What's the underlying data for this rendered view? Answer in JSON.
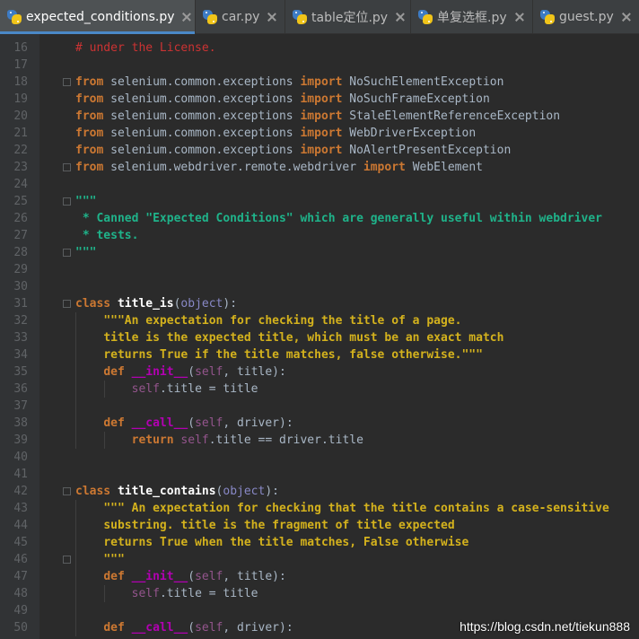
{
  "tabs": [
    {
      "label": "expected_conditions.py",
      "active": true
    },
    {
      "label": "car.py",
      "active": false
    },
    {
      "label": "table定位.py",
      "active": false
    },
    {
      "label": "单复选框.py",
      "active": false
    },
    {
      "label": "guest.py",
      "active": false
    }
  ],
  "lines": [
    {
      "n": "16",
      "tokens": [
        {
          "t": "# under the License.",
          "c": "cmt"
        }
      ]
    },
    {
      "n": "17",
      "tokens": []
    },
    {
      "n": "18",
      "tokens": [
        {
          "t": "from",
          "c": "kw"
        },
        {
          "t": " selenium.common.exceptions ",
          "c": "plain"
        },
        {
          "t": "import",
          "c": "kw"
        },
        {
          "t": " NoSuchElementException",
          "c": "plain"
        }
      ]
    },
    {
      "n": "19",
      "tokens": [
        {
          "t": "from",
          "c": "kw"
        },
        {
          "t": " selenium.common.exceptions ",
          "c": "plain"
        },
        {
          "t": "import",
          "c": "kw"
        },
        {
          "t": " NoSuchFrameException",
          "c": "plain"
        }
      ]
    },
    {
      "n": "20",
      "tokens": [
        {
          "t": "from",
          "c": "kw"
        },
        {
          "t": " selenium.common.exceptions ",
          "c": "plain"
        },
        {
          "t": "import",
          "c": "kw"
        },
        {
          "t": " StaleElementReferenceException",
          "c": "plain"
        }
      ]
    },
    {
      "n": "21",
      "tokens": [
        {
          "t": "from",
          "c": "kw"
        },
        {
          "t": " selenium.common.exceptions ",
          "c": "plain"
        },
        {
          "t": "import",
          "c": "kw"
        },
        {
          "t": " WebDriverException",
          "c": "plain"
        }
      ]
    },
    {
      "n": "22",
      "tokens": [
        {
          "t": "from",
          "c": "kw"
        },
        {
          "t": " selenium.common.exceptions ",
          "c": "plain"
        },
        {
          "t": "import",
          "c": "kw"
        },
        {
          "t": " NoAlertPresentException",
          "c": "plain"
        }
      ]
    },
    {
      "n": "23",
      "tokens": [
        {
          "t": "from",
          "c": "kw"
        },
        {
          "t": " selenium.webdriver.remote.webdriver ",
          "c": "plain"
        },
        {
          "t": "import",
          "c": "kw"
        },
        {
          "t": " WebElement",
          "c": "plain"
        }
      ]
    },
    {
      "n": "24",
      "tokens": []
    },
    {
      "n": "25",
      "tokens": [
        {
          "t": "\"\"\"",
          "c": "doc2"
        }
      ]
    },
    {
      "n": "26",
      "tokens": [
        {
          "t": " * Canned \"Expected Conditions\" which are generally useful within webdriver",
          "c": "doc2"
        }
      ]
    },
    {
      "n": "27",
      "tokens": [
        {
          "t": " * tests.",
          "c": "doc2"
        }
      ]
    },
    {
      "n": "28",
      "tokens": [
        {
          "t": "\"\"\"",
          "c": "doc2"
        }
      ]
    },
    {
      "n": "29",
      "tokens": []
    },
    {
      "n": "30",
      "tokens": []
    },
    {
      "n": "31",
      "tokens": [
        {
          "t": "class",
          "c": "kw"
        },
        {
          "t": " ",
          "c": "plain"
        },
        {
          "t": "title_is",
          "c": "cls"
        },
        {
          "t": "(",
          "c": "plain"
        },
        {
          "t": "object",
          "c": "builtin"
        },
        {
          "t": "):",
          "c": "plain"
        }
      ]
    },
    {
      "n": "32",
      "tokens": [
        {
          "t": "    ",
          "c": "plain"
        },
        {
          "t": "\"\"\"An expectation for checking the title of a page.",
          "c": "doc"
        }
      ]
    },
    {
      "n": "33",
      "tokens": [
        {
          "t": "    ",
          "c": "plain"
        },
        {
          "t": "title is the expected title, which must be an exact match",
          "c": "doc"
        }
      ]
    },
    {
      "n": "34",
      "tokens": [
        {
          "t": "    ",
          "c": "plain"
        },
        {
          "t": "returns True if the title matches, false otherwise.\"\"\"",
          "c": "doc"
        }
      ]
    },
    {
      "n": "35",
      "tokens": [
        {
          "t": "    ",
          "c": "plain"
        },
        {
          "t": "def",
          "c": "kw"
        },
        {
          "t": " ",
          "c": "plain"
        },
        {
          "t": "__init__",
          "c": "magic"
        },
        {
          "t": "(",
          "c": "plain"
        },
        {
          "t": "self",
          "c": "selfkw"
        },
        {
          "t": ", title):",
          "c": "plain"
        }
      ]
    },
    {
      "n": "36",
      "tokens": [
        {
          "t": "        ",
          "c": "plain"
        },
        {
          "t": "self",
          "c": "selfkw"
        },
        {
          "t": ".title = title",
          "c": "plain"
        }
      ]
    },
    {
      "n": "37",
      "tokens": []
    },
    {
      "n": "38",
      "tokens": [
        {
          "t": "    ",
          "c": "plain"
        },
        {
          "t": "def",
          "c": "kw"
        },
        {
          "t": " ",
          "c": "plain"
        },
        {
          "t": "__call__",
          "c": "magic"
        },
        {
          "t": "(",
          "c": "plain"
        },
        {
          "t": "self",
          "c": "selfkw"
        },
        {
          "t": ", driver):",
          "c": "plain"
        }
      ]
    },
    {
      "n": "39",
      "tokens": [
        {
          "t": "        ",
          "c": "plain"
        },
        {
          "t": "return",
          "c": "kw"
        },
        {
          "t": " ",
          "c": "plain"
        },
        {
          "t": "self",
          "c": "selfkw"
        },
        {
          "t": ".title == driver.title",
          "c": "plain"
        }
      ]
    },
    {
      "n": "40",
      "tokens": []
    },
    {
      "n": "41",
      "tokens": []
    },
    {
      "n": "42",
      "tokens": [
        {
          "t": "class",
          "c": "kw"
        },
        {
          "t": " ",
          "c": "plain"
        },
        {
          "t": "title_contains",
          "c": "cls"
        },
        {
          "t": "(",
          "c": "plain"
        },
        {
          "t": "object",
          "c": "builtin"
        },
        {
          "t": "):",
          "c": "plain"
        }
      ]
    },
    {
      "n": "43",
      "tokens": [
        {
          "t": "    ",
          "c": "plain"
        },
        {
          "t": "\"\"\" An expectation for checking that the title contains a case-sensitive",
          "c": "doc"
        }
      ]
    },
    {
      "n": "44",
      "tokens": [
        {
          "t": "    ",
          "c": "plain"
        },
        {
          "t": "substring. title is the fragment of title expected",
          "c": "doc"
        }
      ]
    },
    {
      "n": "45",
      "tokens": [
        {
          "t": "    ",
          "c": "plain"
        },
        {
          "t": "returns True when the title matches, False otherwise",
          "c": "doc"
        }
      ]
    },
    {
      "n": "46",
      "tokens": [
        {
          "t": "    ",
          "c": "plain"
        },
        {
          "t": "\"\"\"",
          "c": "doc"
        }
      ]
    },
    {
      "n": "47",
      "tokens": [
        {
          "t": "    ",
          "c": "plain"
        },
        {
          "t": "def",
          "c": "kw"
        },
        {
          "t": " ",
          "c": "plain"
        },
        {
          "t": "__init__",
          "c": "magic"
        },
        {
          "t": "(",
          "c": "plain"
        },
        {
          "t": "self",
          "c": "selfkw"
        },
        {
          "t": ", title):",
          "c": "plain"
        }
      ]
    },
    {
      "n": "48",
      "tokens": [
        {
          "t": "        ",
          "c": "plain"
        },
        {
          "t": "self",
          "c": "selfkw"
        },
        {
          "t": ".title = title",
          "c": "plain"
        }
      ]
    },
    {
      "n": "49",
      "tokens": []
    },
    {
      "n": "50",
      "tokens": [
        {
          "t": "    ",
          "c": "plain"
        },
        {
          "t": "def",
          "c": "kw"
        },
        {
          "t": " ",
          "c": "plain"
        },
        {
          "t": "__call__",
          "c": "magic"
        },
        {
          "t": "(",
          "c": "plain"
        },
        {
          "t": "self",
          "c": "selfkw"
        },
        {
          "t": ", driver):",
          "c": "plain"
        }
      ]
    }
  ],
  "watermark": "https://blog.csdn.net/tiekun888"
}
